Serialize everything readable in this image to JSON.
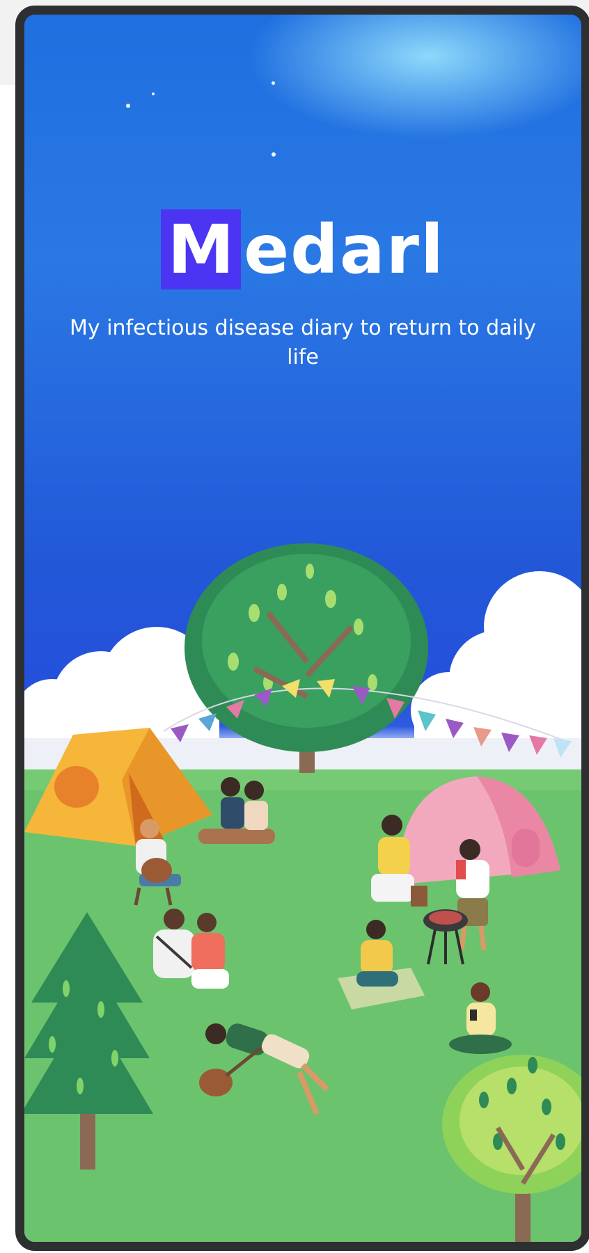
{
  "app": {
    "logo_first_letter": "M",
    "logo_rest": "edarl",
    "tagline": "My infectious disease diary to return to daily life"
  },
  "colors": {
    "frame": "#2e2f31",
    "sky_top": "#1f6fe0",
    "sky_bottom": "#2550dc",
    "logo_accent": "#4b35f2",
    "grass": "#6cc36d"
  },
  "illustration": {
    "icons": [
      "cloud-icon",
      "tree-icon",
      "pine-tree-icon",
      "tent-icon",
      "bunting-icon",
      "bbq-grill-icon",
      "guitar-icon",
      "person-icon"
    ]
  }
}
